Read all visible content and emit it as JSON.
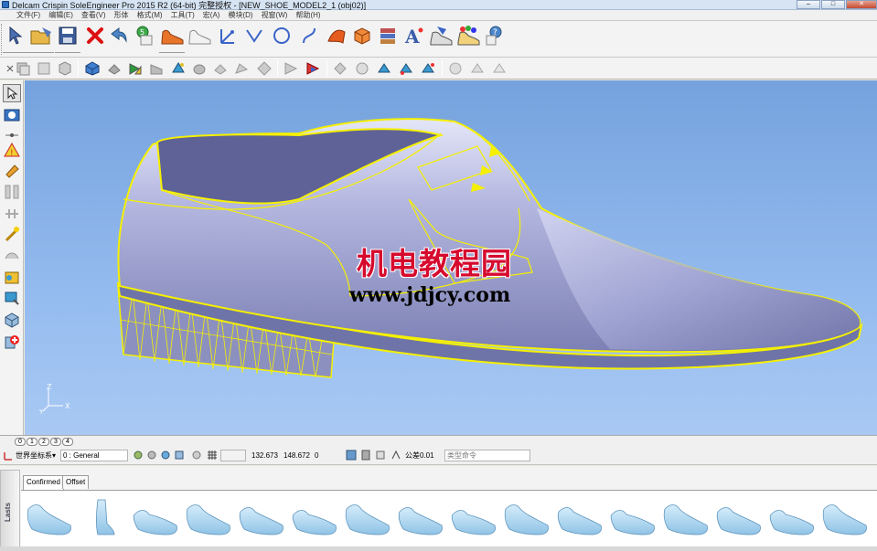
{
  "window": {
    "title": "Delcam Crispin SoleEngineer Pro 2015 R2 (64-bit) 完整授权 - [NEW_SHOE_MODEL2_1 (obj02)]",
    "buttons": [
      "minimize",
      "maximize",
      "close"
    ]
  },
  "menu": {
    "items": [
      "文件(F)",
      "编辑(E)",
      "查看(V)",
      "形体",
      "格式(M)",
      "工具(T)",
      "宏(A)",
      "模块(D)",
      "视窗(W)",
      "帮助(H)"
    ]
  },
  "toolbar_main": {
    "buttons": [
      "select-arrow-icon",
      "open-folder-icon",
      "save-icon",
      "delete-icon",
      "undo-redo-icon",
      "layer-icon",
      "shoe-orange-icon",
      "shoe-white-icon",
      "point-icon",
      "line-icon",
      "circle-icon",
      "curve-icon",
      "surface-icon",
      "solid-icon",
      "layers-icon",
      "text-icon",
      "shoe-tools-icon",
      "shoe-color-icon",
      "help-icon"
    ]
  },
  "toolbar_view": {
    "buttons": [
      "view-cube-icon",
      "view-front-icon",
      "view-side-icon",
      "iso-view-icon",
      "shade-icon",
      "wireframe-icon",
      "mesh-icon",
      "render-icon",
      "light-icon",
      "hide-icon",
      "zoom-icon",
      "pan-icon",
      "rotate-icon",
      "fit-icon",
      "prev-view-icon",
      "next-view-icon",
      "measure-icon",
      "grid-icon",
      "snap-icon",
      "sphere-icon"
    ]
  },
  "left_tools": [
    "select-icon",
    "transform-icon",
    "pin-icon",
    "warning-icon",
    "paint-icon",
    "mirror-icon",
    "align-icon",
    "magic-icon",
    "blend-icon",
    "morph-icon",
    "scan-icon",
    "cube-icon",
    "add-icon"
  ],
  "viewport": {
    "watermark_cn": "机电教程园",
    "watermark_url": "www.jdjcy.com",
    "axis_z": "Z",
    "axis_x": "X",
    "axis_y": "Y"
  },
  "layer_tabs": [
    "0",
    "1",
    "2",
    "3",
    "4"
  ],
  "statusbar": {
    "coord_system": "世界坐标系",
    "layer": "0 : General",
    "x_value": "132.673",
    "y_value": "148.672",
    "z_value": "0",
    "tolerance_label": "公差",
    "tolerance_value": "0.01",
    "command_placeholder": "类型命令"
  },
  "library": {
    "side_label": "Lasts",
    "tabs": [
      "Confirmed",
      "Offset"
    ],
    "active_tab": "Confirmed",
    "thumbnail_count": 16
  },
  "colors": {
    "viewport_top": "#75a2dd",
    "viewport_bottom": "#a9c9f3",
    "shoe_body": "#9a9ecf",
    "edge_highlight": "#f5f000",
    "watermark_cn": "#d60a2e",
    "last_thumb": "#8fc3e6"
  }
}
